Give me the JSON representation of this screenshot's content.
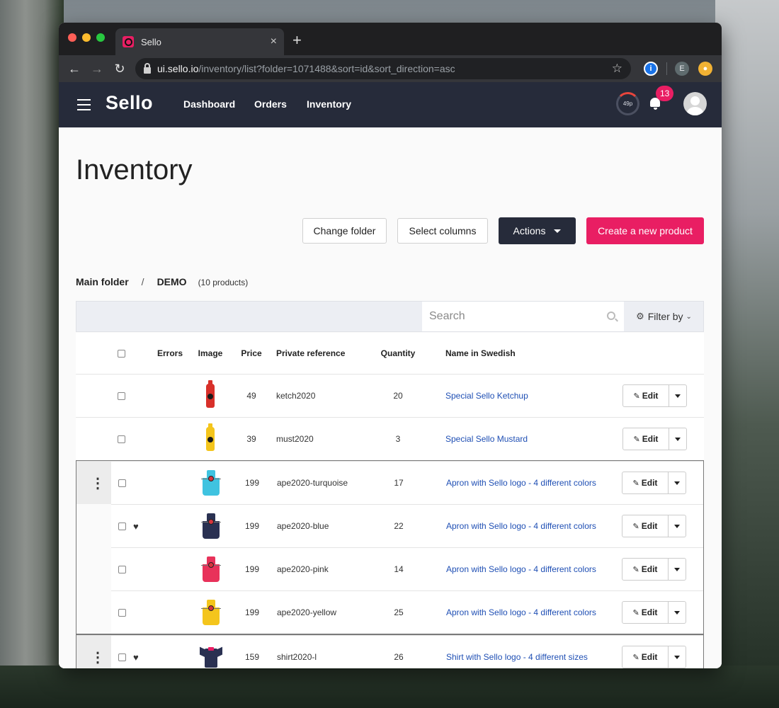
{
  "browser": {
    "tab_title": "Sello",
    "url_host": "ui.sello.io",
    "url_path": "/inventory/list?folder=1071488&sort=id&sort_direction=asc",
    "ext_profile": "E"
  },
  "header": {
    "logo": "Sello",
    "nav": [
      "Dashboard",
      "Orders",
      "Inventory"
    ],
    "gauge_text": "49p",
    "notification_count": "13"
  },
  "page": {
    "title": "Inventory",
    "buttons": {
      "change_folder": "Change folder",
      "select_columns": "Select columns",
      "actions": "Actions",
      "create": "Create a new product"
    },
    "breadcrumb": {
      "main": "Main folder",
      "sep": "/",
      "folder": "DEMO",
      "count": "(10 products)"
    },
    "search_placeholder": "Search",
    "filter_label": "Filter by"
  },
  "table": {
    "headers": {
      "errors": "Errors",
      "image": "Image",
      "price": "Price",
      "ref": "Private reference",
      "qty": "Quantity",
      "name": "Name in Swedish"
    },
    "edit_label": "Edit",
    "rows": [
      {
        "price": "49",
        "ref": "ketch2020",
        "qty": "20",
        "name": "Special Sello Ketchup",
        "img": "ketchup-bottle",
        "color": "#d8302a"
      },
      {
        "price": "39",
        "ref": "must2020",
        "qty": "3",
        "name": "Special Sello Mustard",
        "img": "mustard-bottle",
        "color": "#f4c51c"
      },
      {
        "price": "199",
        "ref": "ape2020-turquoise",
        "qty": "17",
        "name": "Apron with Sello logo - 4 different colors",
        "img": "apron",
        "color": "#3fc3e0"
      },
      {
        "price": "199",
        "ref": "ape2020-blue",
        "qty": "22",
        "name": "Apron with Sello logo - 4 different colors",
        "img": "apron",
        "color": "#2a3152"
      },
      {
        "price": "199",
        "ref": "ape2020-pink",
        "qty": "14",
        "name": "Apron with Sello logo - 4 different colors",
        "img": "apron",
        "color": "#e8325a"
      },
      {
        "price": "199",
        "ref": "ape2020-yellow",
        "qty": "25",
        "name": "Apron with Sello logo - 4 different colors",
        "img": "apron",
        "color": "#f4c51c"
      },
      {
        "price": "159",
        "ref": "shirt2020-l",
        "qty": "26",
        "name": "Shirt with Sello logo - 4 different sizes",
        "img": "shirt",
        "color": "#2a3152"
      }
    ]
  },
  "colors": {
    "brand_pink": "#e91e63",
    "header_bg": "#262b3a",
    "link_blue": "#1f4fb4"
  }
}
